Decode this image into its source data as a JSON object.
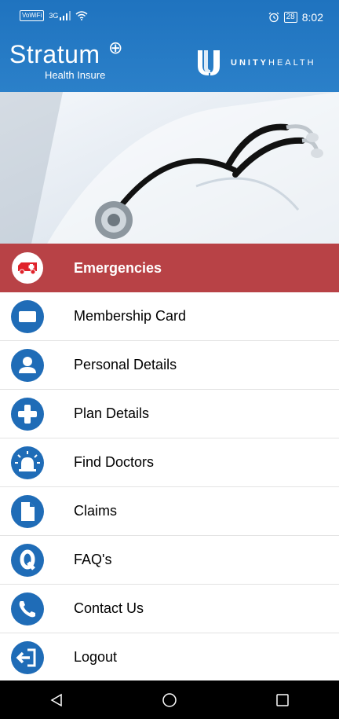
{
  "status_bar": {
    "volte": "VoWiFi",
    "network": "3G",
    "battery": "28",
    "time": "8:02",
    "icons": [
      "wifi-icon",
      "alarm-icon",
      "battery-icon"
    ]
  },
  "header": {
    "brand_name": "Stratum",
    "brand_symbol": "⊕",
    "brand_subtitle": "Health Insure",
    "partner_name_bold": "UNITY",
    "partner_name_rest": "HEALTH",
    "background_color": "#2379c4"
  },
  "hero": {
    "icon": "stethoscope-image"
  },
  "menu": {
    "accent_color": "#1f6cb7",
    "emergency_color": "#b84246",
    "items": [
      {
        "label": "Emergencies",
        "icon": "ambulance-icon"
      },
      {
        "label": "Membership Card",
        "icon": "card-icon"
      },
      {
        "label": "Personal Details",
        "icon": "user-icon"
      },
      {
        "label": "Plan Details",
        "icon": "plus-icon"
      },
      {
        "label": "Find Doctors",
        "icon": "siren-icon"
      },
      {
        "label": "Claims",
        "icon": "document-icon"
      },
      {
        "label": "FAQ's",
        "icon": "faq-icon"
      },
      {
        "label": "Contact Us",
        "icon": "phone-icon"
      },
      {
        "label": "Logout",
        "icon": "logout-icon"
      }
    ]
  },
  "nav_bar": {
    "buttons": [
      "back-icon",
      "home-icon",
      "recents-icon"
    ]
  }
}
